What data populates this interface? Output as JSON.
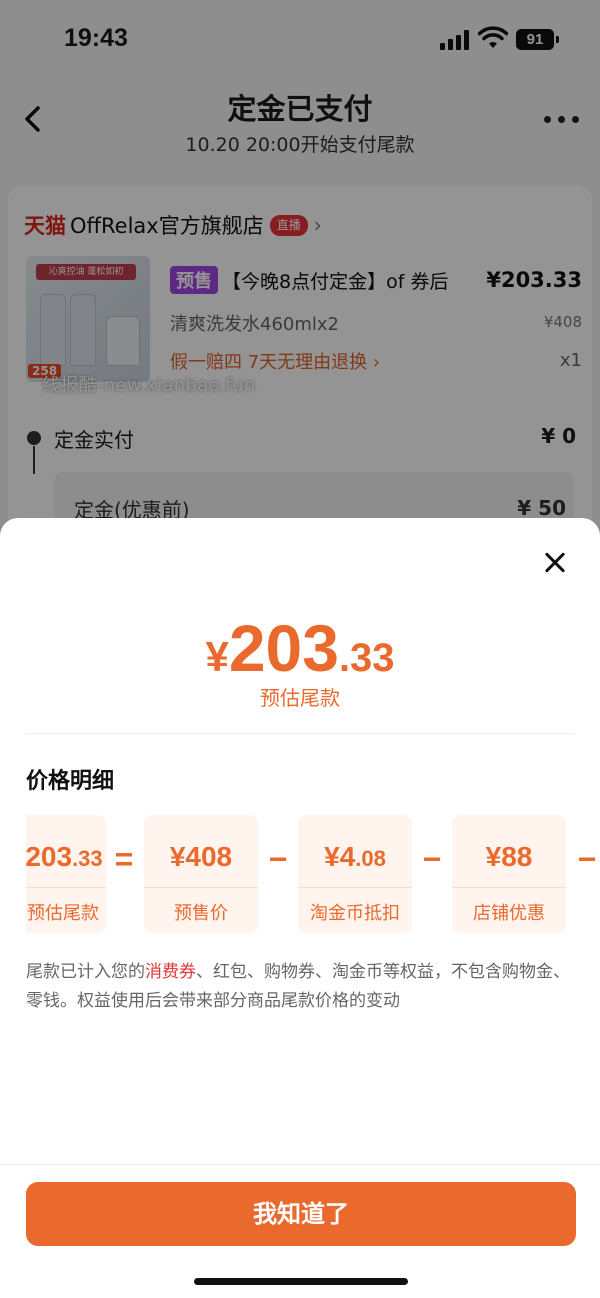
{
  "status_bar": {
    "time": "19:43",
    "battery": "91"
  },
  "nav": {
    "title": "定金已支付",
    "subtitle": "10.20 20:00开始支付尾款"
  },
  "shop": {
    "platform": "天猫",
    "name": "OffRelax官方旗舰店",
    "live_badge": "直播"
  },
  "product": {
    "image_banner": "沁爽控油 蓬松如初",
    "image_price": "258",
    "presale_tag": "预售",
    "title": "【今晚8点付定金】of 券后",
    "coupon_price": "¥203.33",
    "spec": "清爽洗发水460mlx2",
    "spec_price": "¥408",
    "guarantee": "假一赔四  7天无理由退换 ›",
    "quantity": "x1"
  },
  "watermark": "线报酷-new.xianbao.fun",
  "deposit": {
    "label": "定金实付",
    "value": "¥ 0",
    "sub_label": "定金(优惠前)",
    "sub_value": "¥ 50"
  },
  "sheet": {
    "price": {
      "currency": "¥",
      "integer": "203",
      "decimal": ".33"
    },
    "price_label": "预估尾款",
    "detail_title": "价格明细",
    "breakdown": [
      {
        "value_main": "203",
        "value_small": ".33",
        "label": "预估尾款"
      },
      {
        "op": "="
      },
      {
        "value_main": "¥408",
        "value_small": "",
        "label": "预售价"
      },
      {
        "op": "−"
      },
      {
        "value_main": "¥4",
        "value_small": ".08",
        "label": "淘金币抵扣"
      },
      {
        "op": "−"
      },
      {
        "value_main": "¥88",
        "value_small": "",
        "label": "店铺优惠"
      },
      {
        "op": "−"
      }
    ],
    "note_prefix": "尾款已计入您的",
    "note_highlight": "消费券",
    "note_suffix": "、红包、购物券、淘金币等权益，不包含购物金、零钱。权益使用后会带来部分商品尾款价格的变动",
    "confirm_label": "我知道了"
  },
  "colors": {
    "accent": "#ea6a2e",
    "presale_tag": "#a245e6",
    "tmall": "#e0251f",
    "highlight": "#e0363a"
  }
}
